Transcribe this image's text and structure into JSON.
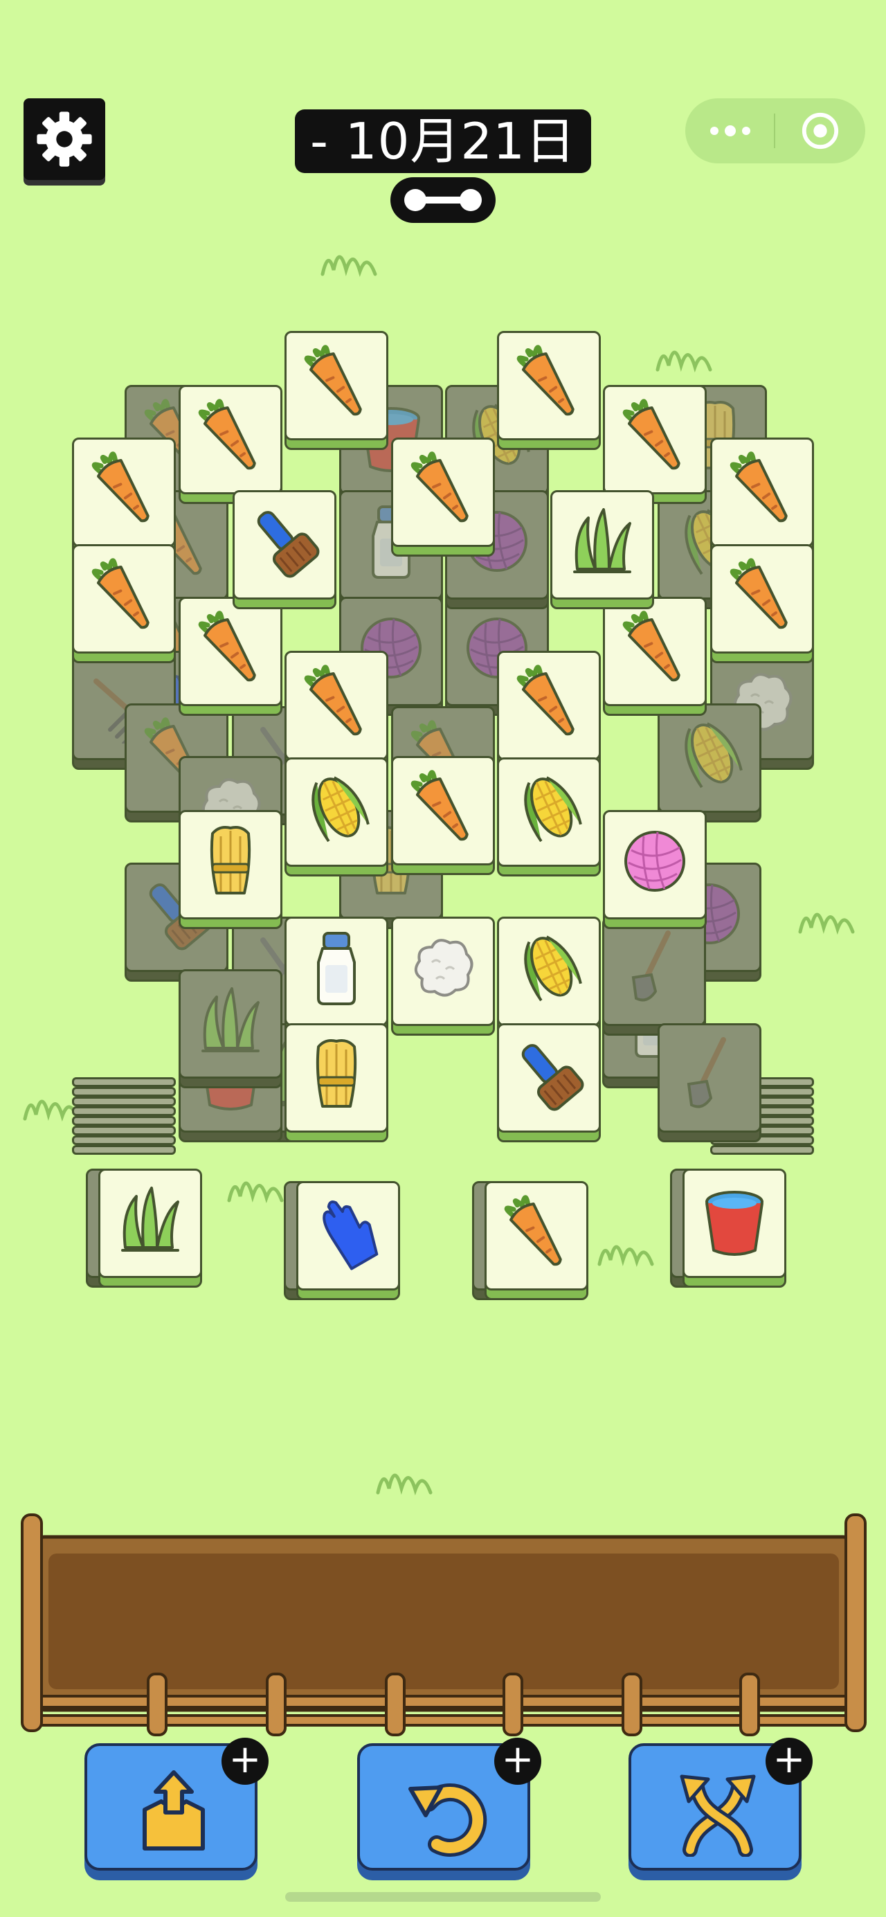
{
  "header": {
    "date_label": "- 10月21日 -",
    "settings_icon": "gear-icon",
    "progress_icon": "progress-bar-icon",
    "capsule": {
      "more_icon": "more-dots-icon",
      "close_icon": "target-circle-icon"
    }
  },
  "board": {
    "top_tiles": [
      {
        "item": "carrot"
      },
      {
        "item": "carrot"
      },
      {
        "item": "carrot"
      },
      {
        "item": "carrot"
      },
      {
        "item": "carrot"
      },
      {
        "item": "carrot"
      },
      {
        "item": "carrot"
      },
      {
        "item": "carrot"
      },
      {
        "item": "carrot"
      },
      {
        "item": "carrot"
      },
      {
        "item": "carrot"
      },
      {
        "item": "carrot"
      },
      {
        "item": "carrot"
      },
      {
        "item": "carrot"
      },
      {
        "item": "brush"
      },
      {
        "item": "grass"
      },
      {
        "item": "corn"
      },
      {
        "item": "corn"
      },
      {
        "item": "wheat"
      },
      {
        "item": "yarn-pink"
      },
      {
        "item": "milk-bottle"
      },
      {
        "item": "cotton"
      },
      {
        "item": "corn"
      },
      {
        "item": "wheat"
      },
      {
        "item": "brush"
      }
    ],
    "bottom_row_tiles": [
      {
        "item": "grass"
      },
      {
        "item": "glove"
      },
      {
        "item": "carrot"
      },
      {
        "item": "bucket"
      }
    ],
    "covered_tiles": [
      {
        "item": "bucket"
      },
      {
        "item": "corn"
      },
      {
        "item": "wheat"
      },
      {
        "item": "carrot"
      },
      {
        "item": "milk-bottle"
      },
      {
        "item": "yarn-purple"
      },
      {
        "item": "yarn-purple"
      },
      {
        "item": "yarn-purple"
      },
      {
        "item": "corn"
      },
      {
        "item": "carrot"
      },
      {
        "item": "carrot"
      },
      {
        "item": "glove"
      },
      {
        "item": "rake"
      },
      {
        "item": "scissors"
      },
      {
        "item": "cotton"
      },
      {
        "item": "corn"
      },
      {
        "item": "carrot"
      },
      {
        "item": "cotton"
      },
      {
        "item": "brush"
      },
      {
        "item": "yarn-purple"
      },
      {
        "item": "scissors"
      },
      {
        "item": "grass"
      },
      {
        "item": "bucket"
      },
      {
        "item": "grass"
      },
      {
        "item": "milk-bottle"
      },
      {
        "item": "shovel"
      },
      {
        "item": "shovel"
      },
      {
        "item": "carrot"
      },
      {
        "item": "wheat"
      }
    ]
  },
  "tray": {
    "slots_filled": 0
  },
  "boosters": [
    {
      "name": "move-out",
      "icon": "move-out-icon",
      "plus_label": "+"
    },
    {
      "name": "undo",
      "icon": "undo-icon",
      "plus_label": "+"
    },
    {
      "name": "shuffle",
      "icon": "shuffle-icon",
      "plus_label": "+"
    }
  ],
  "colors": {
    "background": "#d1fa9c",
    "tile_face": "#f7fbdd",
    "tile_base": "#84bc52",
    "tile_dim": "#8a9276",
    "booster": "#4f9cf0",
    "tray_wood": "#b5813d"
  }
}
